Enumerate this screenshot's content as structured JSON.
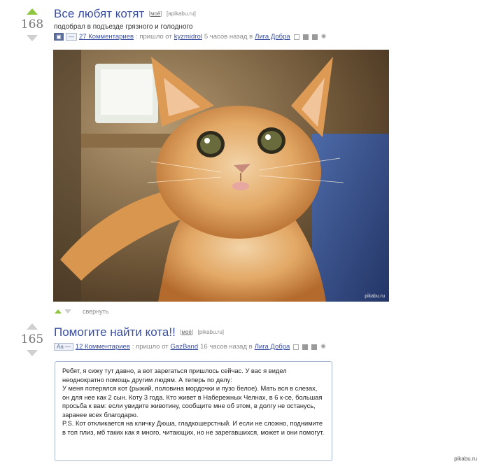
{
  "posts": [
    {
      "rating": "168",
      "title": "Все любят котят",
      "tags": [
        "моё",
        "apikabu.ru"
      ],
      "subtitle": "подобрал в подъезде грязного и голодного",
      "comments": "27 Комментариев",
      "from_label": ": пришло от",
      "author": "kyzmidrol",
      "time": "5 часов назад в",
      "community": "Лига Добра",
      "image_watermark": "pikabu.ru"
    },
    {
      "rating": "165",
      "title": "Помогите найти кота!!",
      "tags": [
        "моё",
        "pikabu.ru"
      ],
      "badge": "Aa",
      "comments": "12 Комментариев",
      "from_label": ": пришло от",
      "author": "GazBand",
      "time": "16 часов назад в",
      "community": "Лига Добра",
      "story": [
        "Ребят, я сижу тут давно, а вот зарегаться пришлось сейчас. У вас я видел неоднократно помощь другим людям. А теперь по делу:",
        "У меня потерялся кот (рыжий, половина мордочки и пузо белое). Мать вся в слезах, он для нее как 2 сын. Коту 3 года. Кто живет в Набережных Челнах, в 6 к-се, большая просьба к вам: если увидите животину, сообщите мне об этом, в долгу не останусь, заранее всех благодарю.",
        "P.S. Кот откликается на кличку Дюша, гладкошерстный. И если не сложно, поднимите в топ плиз, мб таких как я много, читающих, но не зарегавшихся, может и они помогут."
      ]
    }
  ],
  "collapse_label": "свернуть",
  "site_watermark": "pikabu.ru",
  "colors": {
    "vote_up": "#8ec63f",
    "link": "#3a4fa0",
    "story_border": "#a7b6d0"
  }
}
